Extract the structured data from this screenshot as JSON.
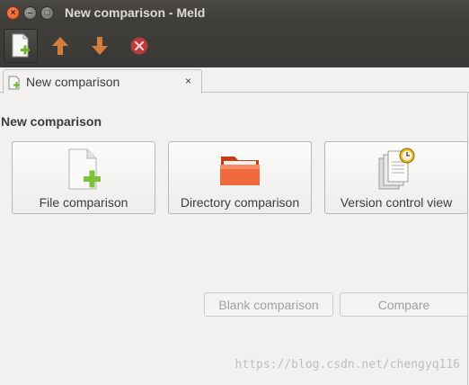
{
  "window": {
    "title": "New comparison - Meld",
    "controls": {
      "close": "×",
      "minimize": "–",
      "maximize": "□"
    }
  },
  "toolbar": {
    "items": [
      {
        "icon": "new-comparison-icon",
        "active": true
      },
      {
        "icon": "arrow-up-icon",
        "color": "#d47d3d"
      },
      {
        "icon": "arrow-down-icon",
        "color": "#d47d3d"
      },
      {
        "icon": "stop-icon",
        "color": "#b93a3a"
      }
    ]
  },
  "tabs": [
    {
      "label": "New comparison",
      "close": "×"
    }
  ],
  "main": {
    "heading": "New comparison",
    "options": [
      {
        "label": "File comparison",
        "icon": "file-add-icon"
      },
      {
        "label": "Directory comparison",
        "icon": "folder-icon",
        "color": "#e8532a"
      },
      {
        "label": "Version control view",
        "icon": "version-control-icon"
      }
    ],
    "actions": {
      "blank": "Blank comparison",
      "compare": "Compare"
    }
  },
  "watermark": "https://blog.csdn.net/chengyq116"
}
